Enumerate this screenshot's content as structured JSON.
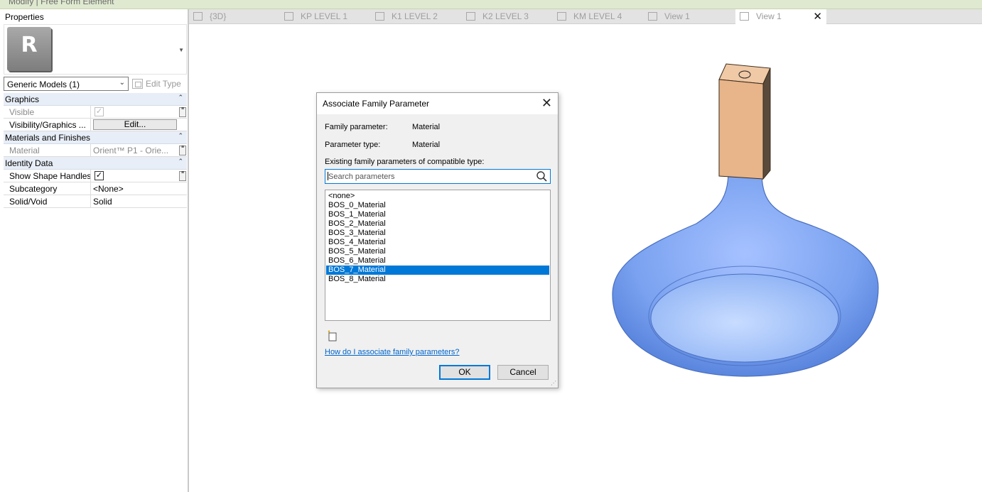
{
  "ribbon": {
    "context_label": "Modify | Free Form Element"
  },
  "properties": {
    "title": "Properties",
    "type_selector": "Generic Models (1)",
    "edit_type_label": "Edit Type",
    "groups": [
      {
        "name": "Graphics",
        "rows": [
          {
            "name": "Visible",
            "value": "",
            "kind": "checkbox-disabled",
            "checked": true
          },
          {
            "name": "Visibility/Graphics ...",
            "value": "Edit...",
            "kind": "button"
          }
        ]
      },
      {
        "name": "Materials and Finishes",
        "rows": [
          {
            "name": "Material",
            "value": "Orient™ P1 - Orie...",
            "kind": "text-disabled"
          }
        ]
      },
      {
        "name": "Identity Data",
        "rows": [
          {
            "name": "Show Shape Handles",
            "value": "",
            "kind": "checkbox",
            "checked": true
          },
          {
            "name": "Subcategory",
            "value": "<None>",
            "kind": "text"
          },
          {
            "name": "Solid/Void",
            "value": "Solid",
            "kind": "text"
          }
        ]
      }
    ]
  },
  "tabs": [
    {
      "label": "{3D}",
      "icon": "3d-view-icon"
    },
    {
      "label": "KP LEVEL 1",
      "icon": "floor-plan-icon"
    },
    {
      "label": "K1 LEVEL 2",
      "icon": "floor-plan-icon"
    },
    {
      "label": "K2 LEVEL 3",
      "icon": "floor-plan-icon"
    },
    {
      "label": "KM LEVEL 4",
      "icon": "floor-plan-icon"
    },
    {
      "label": "View 1",
      "icon": "3d-view-icon"
    },
    {
      "label": "View 1",
      "icon": "3d-view-icon",
      "active": true
    }
  ],
  "dialog": {
    "title": "Associate Family Parameter",
    "family_parameter_label": "Family parameter:",
    "family_parameter_value": "Material",
    "parameter_type_label": "Parameter type:",
    "parameter_type_value": "Material",
    "existing_label": "Existing family parameters of compatible type:",
    "search_placeholder": "Search parameters",
    "list": [
      "<none>",
      "BOS_0_Material",
      "BOS_1_Material",
      "BOS_2_Material",
      "BOS_3_Material",
      "BOS_4_Material",
      "BOS_5_Material",
      "BOS_6_Material",
      "BOS_7_Material",
      "BOS_8_Material"
    ],
    "selected_item": "BOS_7_Material",
    "help_link": "How do I associate family parameters?",
    "ok_label": "OK",
    "cancel_label": "Cancel"
  },
  "colors": {
    "selection": "#0078d7",
    "group_header": "#e8eef7",
    "model_blue": "#7aa2f0",
    "model_block": "#e8b48a"
  }
}
